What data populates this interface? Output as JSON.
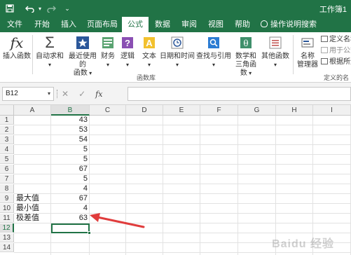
{
  "window": {
    "title": "工作簿1",
    "accent_color": "#217346"
  },
  "quick_access": {
    "save_icon": "save-icon",
    "undo_icon": "undo-icon",
    "redo_icon": "redo-icon",
    "customize_icon": "chevron-down-icon"
  },
  "tabs": [
    {
      "label": "文件"
    },
    {
      "label": "开始"
    },
    {
      "label": "插入"
    },
    {
      "label": "页面布局"
    },
    {
      "label": "公式",
      "active": true
    },
    {
      "label": "数据"
    },
    {
      "label": "审阅"
    },
    {
      "label": "视图"
    },
    {
      "label": "帮助"
    },
    {
      "label": "操作说明搜索"
    }
  ],
  "ribbon": {
    "insert_function": {
      "label": "插入函数",
      "icon": "fx-icon"
    },
    "autosum": {
      "label": "自动求和",
      "icon": "sigma-icon"
    },
    "recent": {
      "label1": "最近使用的",
      "label2": "函数",
      "icon": "star-icon"
    },
    "financial": {
      "label": "财务",
      "icon": "financial-icon"
    },
    "logical": {
      "label": "逻辑",
      "icon": "question-icon"
    },
    "text": {
      "label": "文本",
      "icon": "text-a-icon"
    },
    "datetime": {
      "label": "日期和时间",
      "icon": "clock-icon"
    },
    "lookup": {
      "label": "查找与引用",
      "icon": "search-icon"
    },
    "math": {
      "label1": "数学和",
      "label2": "三角函数",
      "icon": "theta-icon"
    },
    "other": {
      "label": "其他函数",
      "icon": "more-icon"
    },
    "function_library_label": "函数库",
    "name_manager": {
      "label1": "名称",
      "label2": "管理器",
      "icon": "tag-icon"
    },
    "define_name": "定义名称",
    "use_in_formula": "用于公式",
    "create_from_selection": "根据所选",
    "defined_names_label": "定义的名"
  },
  "formula_bar": {
    "name_box": "B12",
    "cancel_glyph": "✕",
    "enter_glyph": "✓",
    "fx_glyph": "fx",
    "formula": ""
  },
  "sheet": {
    "columns": [
      "A",
      "B",
      "C",
      "D",
      "E",
      "F",
      "G",
      "H",
      "I"
    ],
    "rows": [
      "1",
      "2",
      "3",
      "4",
      "5",
      "6",
      "7",
      "8",
      "9",
      "10",
      "11",
      "12",
      "13",
      "14"
    ],
    "col_b_values": [
      "43",
      "53",
      "54",
      "5",
      "5",
      "67",
      "5",
      "4",
      "67",
      "4",
      "63"
    ],
    "col_a_labels": {
      "row9": "最大值",
      "row10": "最小值",
      "row11": "极差值"
    },
    "selected_cell": "B12"
  },
  "annotation": {
    "arrow_color": "#e03c3c"
  },
  "watermark": "Baidu 经验"
}
